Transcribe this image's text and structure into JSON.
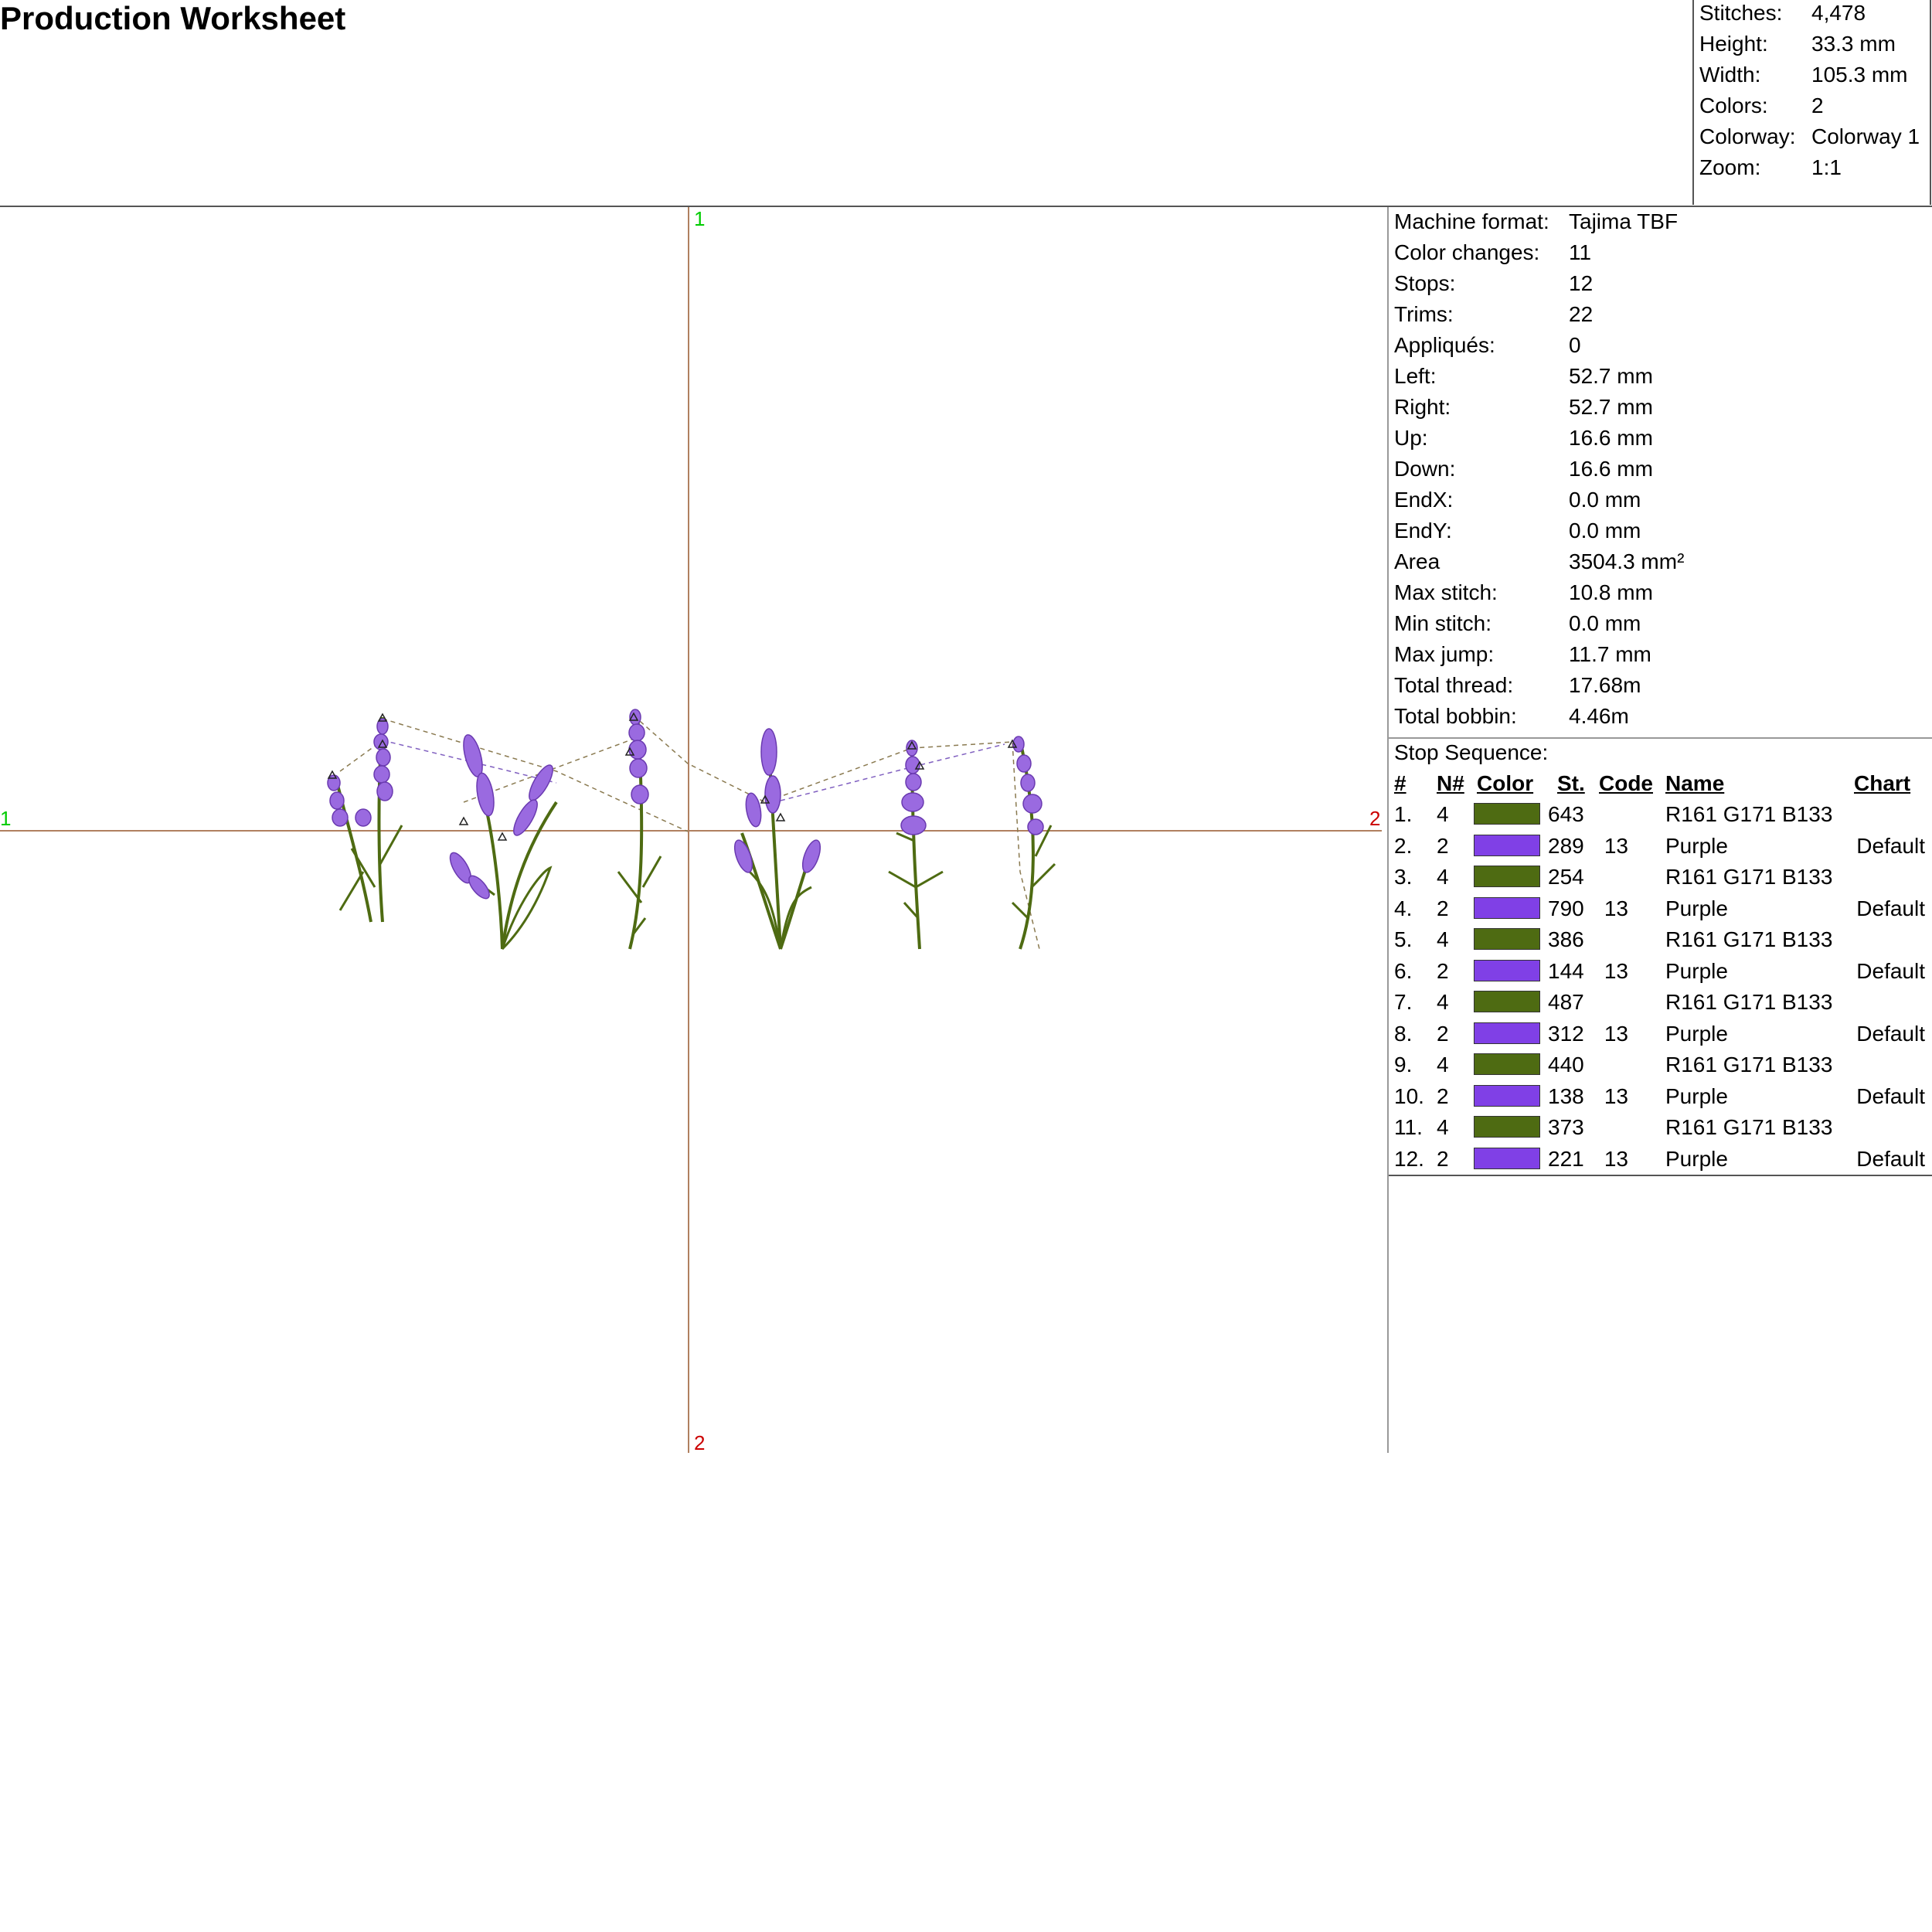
{
  "title": "Production Worksheet",
  "summary": [
    {
      "label": "Stitches:",
      "value": "4,478"
    },
    {
      "label": "Height:",
      "value": "33.3 mm"
    },
    {
      "label": "Width:",
      "value": "105.3 mm"
    },
    {
      "label": "Colors:",
      "value": "2"
    },
    {
      "label": "Colorway:",
      "value": "Colorway 1"
    },
    {
      "label": "Zoom:",
      "value": "1:1"
    }
  ],
  "axis_marks": {
    "top": "1",
    "left": "1",
    "right": "2",
    "bottom": "2"
  },
  "stats": [
    {
      "label": "Machine format:",
      "value": "Tajima TBF"
    },
    {
      "label": "Color changes:",
      "value": "11"
    },
    {
      "label": "Stops:",
      "value": "12"
    },
    {
      "label": "Trims:",
      "value": "22"
    },
    {
      "label": "Appliqués:",
      "value": "0"
    },
    {
      "label": "Left:",
      "value": "52.7 mm"
    },
    {
      "label": "Right:",
      "value": "52.7 mm"
    },
    {
      "label": "Up:",
      "value": "16.6 mm"
    },
    {
      "label": "Down:",
      "value": "16.6 mm"
    },
    {
      "label": "EndX:",
      "value": "0.0 mm"
    },
    {
      "label": "EndY:",
      "value": "0.0 mm"
    },
    {
      "label": "Area",
      "value": "3504.3 mm²"
    },
    {
      "label": "Max stitch:",
      "value": "10.8 mm"
    },
    {
      "label": "Min stitch:",
      "value": "0.0 mm"
    },
    {
      "label": "Max jump:",
      "value": "11.7 mm"
    },
    {
      "label": "Total thread:",
      "value": "17.68m"
    },
    {
      "label": "Total bobbin:",
      "value": "4.46m"
    }
  ],
  "stop_sequence": {
    "title": "Stop Sequence:",
    "headers": {
      "num": "#",
      "needle": "N#",
      "color": "Color",
      "stitches": "St.",
      "code": "Code",
      "name": "Name",
      "chart": "Chart"
    },
    "rows": [
      {
        "num": "1.",
        "needle": "4",
        "color": "#4e6b12",
        "stitches": "643",
        "code": "",
        "name": "R161 G171 B133",
        "chart": ""
      },
      {
        "num": "2.",
        "needle": "2",
        "color": "#8040e6",
        "stitches": "289",
        "code": "13",
        "name": "Purple",
        "chart": "Default"
      },
      {
        "num": "3.",
        "needle": "4",
        "color": "#4e6b12",
        "stitches": "254",
        "code": "",
        "name": "R161 G171 B133",
        "chart": ""
      },
      {
        "num": "4.",
        "needle": "2",
        "color": "#8040e6",
        "stitches": "790",
        "code": "13",
        "name": "Purple",
        "chart": "Default"
      },
      {
        "num": "5.",
        "needle": "4",
        "color": "#4e6b12",
        "stitches": "386",
        "code": "",
        "name": "R161 G171 B133",
        "chart": ""
      },
      {
        "num": "6.",
        "needle": "2",
        "color": "#8040e6",
        "stitches": "144",
        "code": "13",
        "name": "Purple",
        "chart": "Default"
      },
      {
        "num": "7.",
        "needle": "4",
        "color": "#4e6b12",
        "stitches": "487",
        "code": "",
        "name": "R161 G171 B133",
        "chart": ""
      },
      {
        "num": "8.",
        "needle": "2",
        "color": "#8040e6",
        "stitches": "312",
        "code": "13",
        "name": "Purple",
        "chart": "Default"
      },
      {
        "num": "9.",
        "needle": "4",
        "color": "#4e6b12",
        "stitches": "440",
        "code": "",
        "name": "R161 G171 B133",
        "chart": ""
      },
      {
        "num": "10.",
        "needle": "2",
        "color": "#8040e6",
        "stitches": "138",
        "code": "13",
        "name": "Purple",
        "chart": "Default"
      },
      {
        "num": "11.",
        "needle": "4",
        "color": "#4e6b12",
        "stitches": "373",
        "code": "",
        "name": "R161 G171 B133",
        "chart": ""
      },
      {
        "num": "12.",
        "needle": "2",
        "color": "#8040e6",
        "stitches": "221",
        "code": "13",
        "name": "Purple",
        "chart": "Default"
      }
    ]
  },
  "colors": {
    "stem": "#4e6b12",
    "flower": "#8040e6",
    "axis_line": "#b08060",
    "axis_mark_start": "#00cc00",
    "axis_mark_end": "#cc0000"
  }
}
